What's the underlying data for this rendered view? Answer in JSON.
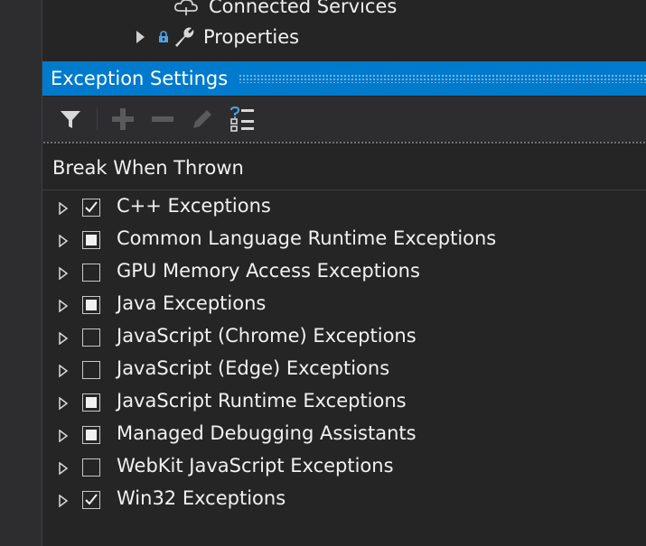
{
  "solution_explorer": {
    "connected_services_label": "Connected Services",
    "properties_label": "Properties"
  },
  "exception_settings": {
    "title": "Exception Settings",
    "toolbar": {
      "icons": [
        "filter-icon",
        "add-icon",
        "remove-icon",
        "edit-icon",
        "restore-defaults-icon"
      ]
    },
    "column_header": "Break When Thrown",
    "items": [
      {
        "label": "C++ Exceptions",
        "state": "checked"
      },
      {
        "label": "Common Language Runtime Exceptions",
        "state": "indeterminate"
      },
      {
        "label": "GPU Memory Access Exceptions",
        "state": "unchecked"
      },
      {
        "label": "Java Exceptions",
        "state": "indeterminate"
      },
      {
        "label": "JavaScript (Chrome) Exceptions",
        "state": "unchecked"
      },
      {
        "label": "JavaScript (Edge) Exceptions",
        "state": "unchecked"
      },
      {
        "label": "JavaScript Runtime Exceptions",
        "state": "indeterminate"
      },
      {
        "label": "Managed Debugging Assistants",
        "state": "indeterminate"
      },
      {
        "label": "WebKit JavaScript Exceptions",
        "state": "unchecked"
      },
      {
        "label": "Win32 Exceptions",
        "state": "checked"
      }
    ]
  },
  "colors": {
    "accent": "#007acc",
    "background": "#252526",
    "toolbar": "#2d2d30"
  }
}
